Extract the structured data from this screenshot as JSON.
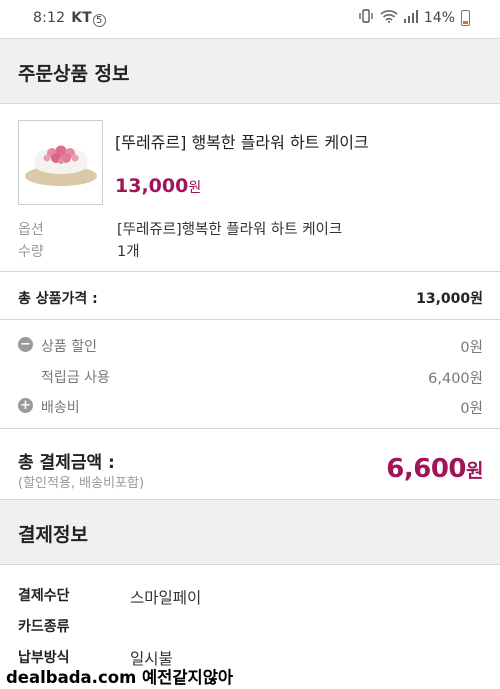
{
  "status_bar": {
    "time": "8:12",
    "carrier": "KT",
    "carrier_badge": "5",
    "battery": "14%"
  },
  "order_section": {
    "title": "주문상품 정보"
  },
  "product": {
    "name": "[뚜레쥬르] 행복한 플라워 하트 케이크",
    "price": "13,000",
    "price_unit": "원",
    "image_icon": "cake-image"
  },
  "options": {
    "option_label": "옵션",
    "option_value": "[뚜레쥬르]행복한 플라워 하트 케이크",
    "qty_label": "수량",
    "qty_value": "1개"
  },
  "totals": {
    "total_label": "총 상품가격 :",
    "total_value": "13,000원",
    "discount_label": "상품 할인",
    "discount_value": "0원",
    "points_label": "적립금 사용",
    "points_value": "6,400원",
    "shipping_label": "배송비",
    "shipping_value": "0원"
  },
  "payment_total": {
    "label": "총 결제금액 :",
    "sub": "(할인적용, 배송비포함)",
    "amount": "6,600",
    "unit": "원"
  },
  "payment_info": {
    "title": "결제정보",
    "method_label": "결제수단",
    "method_value": "스마일페이",
    "card_label": "카드종류",
    "installment_label": "납부방식",
    "installment_value": "일시불"
  },
  "watermark": "dealbada.com 예전같지않아",
  "colors": {
    "accent": "#a01558",
    "section_bg": "#f0f0f0"
  }
}
